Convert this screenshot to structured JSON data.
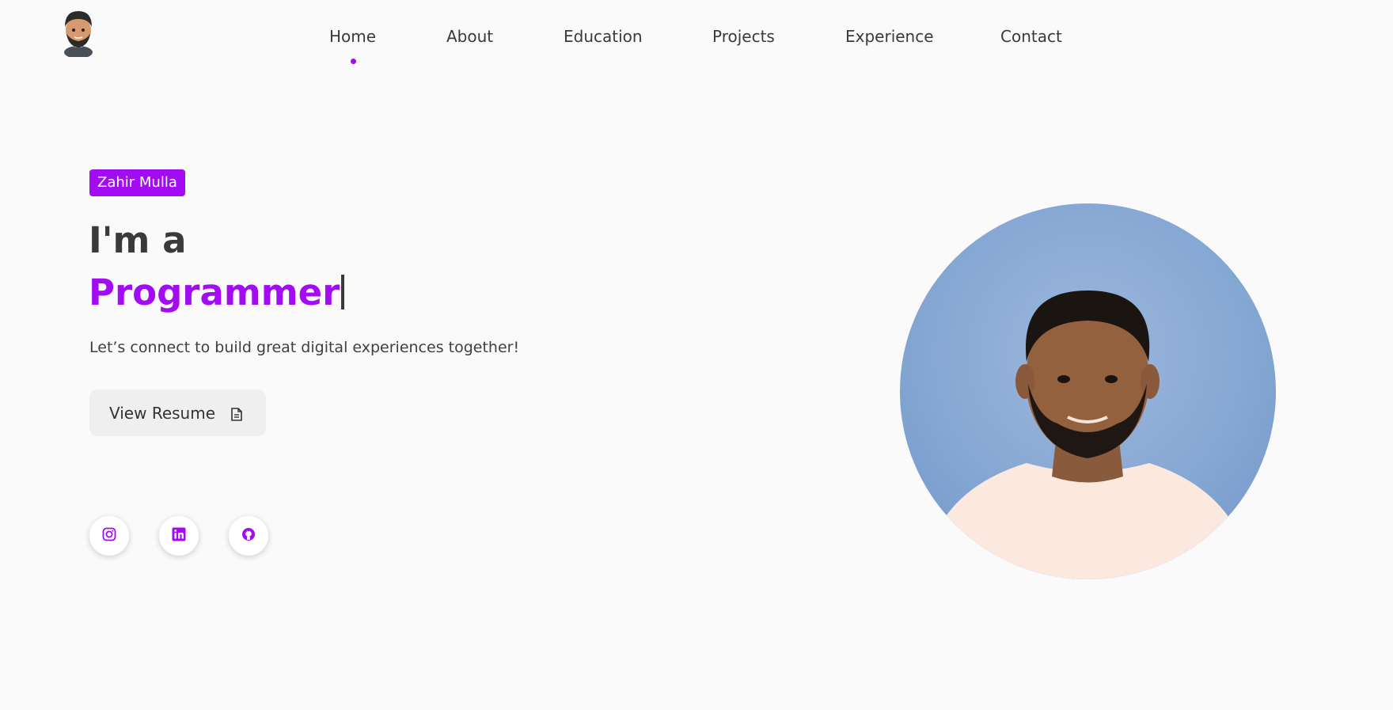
{
  "nav": {
    "items": [
      {
        "label": "Home",
        "active": true
      },
      {
        "label": "About",
        "active": false
      },
      {
        "label": "Education",
        "active": false
      },
      {
        "label": "Projects",
        "active": false
      },
      {
        "label": "Experience",
        "active": false
      },
      {
        "label": "Contact",
        "active": false
      }
    ]
  },
  "hero": {
    "name_badge": "Zahir Mulla",
    "intro": "I'm a",
    "role": "Programmer",
    "tagline": "Let’s connect to build great digital experiences together!",
    "resume_label": "View Resume",
    "resume_icon": "file-text-icon"
  },
  "socials": [
    {
      "name": "instagram",
      "icon": "instagram-icon"
    },
    {
      "name": "linkedin",
      "icon": "linkedin-icon"
    },
    {
      "name": "github",
      "icon": "github-icon"
    }
  ],
  "colors": {
    "accent": "#a30cf3",
    "text": "#3a3a3a",
    "background": "#fafafa",
    "button_bg": "#efefef",
    "photo_bg": "#85a7d3"
  }
}
